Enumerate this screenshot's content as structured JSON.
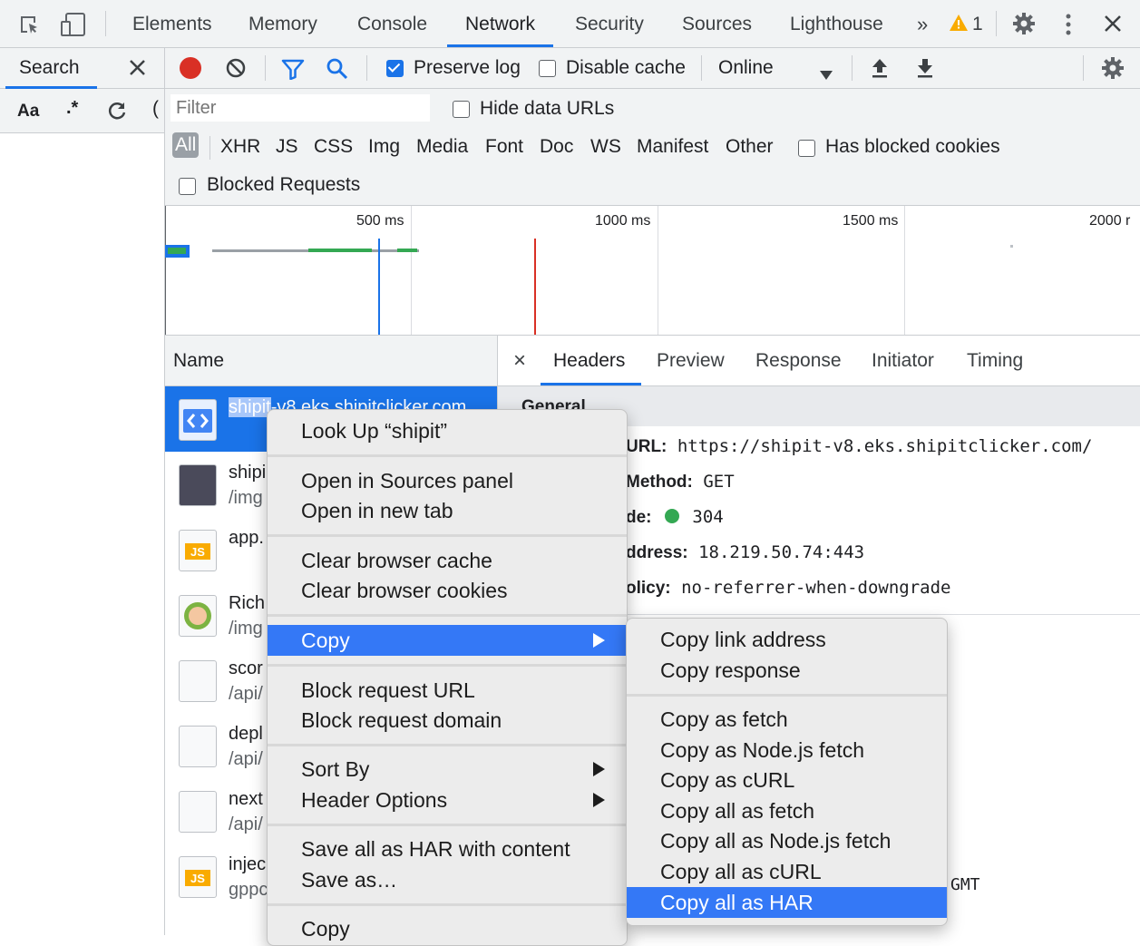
{
  "top_tabs": [
    "Elements",
    "Memory",
    "Console",
    "Network",
    "Security",
    "Sources",
    "Lighthouse"
  ],
  "top_right": {
    "overflow": "»",
    "warning_count": "1"
  },
  "search_panel": {
    "title": "Search",
    "case_toggle": "Aa",
    "regex_toggle": ".*"
  },
  "toolbar": {
    "preserve_log": "Preserve log",
    "disable_cache": "Disable cache",
    "throttle": "Online"
  },
  "filter": {
    "placeholder": "Filter",
    "hide_data_urls": "Hide data URLs",
    "types": [
      "All",
      "XHR",
      "JS",
      "CSS",
      "Img",
      "Media",
      "Font",
      "Doc",
      "WS",
      "Manifest",
      "Other"
    ],
    "has_blocked_cookies": "Has blocked cookies",
    "blocked_requests": "Blocked Requests"
  },
  "overview": {
    "ticks": [
      "500 ms",
      "1000 ms",
      "1500 ms",
      "2000 r"
    ]
  },
  "requests": {
    "column": "Name",
    "rows": [
      {
        "name": "shipit-v8.eks.shipitclicker.com",
        "path": "",
        "highlight": "shipit"
      },
      {
        "name": "shipi",
        "path": "/img"
      },
      {
        "name": "app.",
        "path": ""
      },
      {
        "name": "Rich",
        "path": "/img"
      },
      {
        "name": "scor",
        "path": "/api/"
      },
      {
        "name": "depl",
        "path": "/api/"
      },
      {
        "name": "next",
        "path": "/api/"
      },
      {
        "name": "injec",
        "path": "gppc"
      }
    ]
  },
  "details": {
    "close": "×",
    "tabs": [
      "Headers",
      "Preview",
      "Response",
      "Initiator",
      "Timing"
    ],
    "section": "General",
    "lines": [
      {
        "key": "URL:",
        "value": "https://shipit-v8.eks.shipitclicker.com/"
      },
      {
        "key": "Method:",
        "value": "GET"
      },
      {
        "key": "de:",
        "value": "304"
      },
      {
        "key": "ddress:",
        "value": "18.219.50.74:443"
      },
      {
        "key": "olicy:",
        "value": "no-referrer-when-downgrade"
      }
    ],
    "partial_gmt": "GMT"
  },
  "context_menu": {
    "items": [
      "Look Up “shipit”",
      "Open in Sources panel",
      "Open in new tab",
      "Clear browser cache",
      "Clear browser cookies",
      "Copy",
      "Block request URL",
      "Block request domain",
      "Sort By",
      "Header Options",
      "Save all as HAR with content",
      "Save as…",
      "Copy"
    ]
  },
  "copy_submenu": {
    "items": [
      "Copy link address",
      "Copy response",
      "Copy as fetch",
      "Copy as Node.js fetch",
      "Copy as cURL",
      "Copy all as fetch",
      "Copy all as Node.js fetch",
      "Copy all as cURL",
      "Copy all as HAR"
    ]
  },
  "colors": {
    "accent": "#1a73e8",
    "menu_highlight": "#3478f6",
    "record_red": "#d93025",
    "status_green": "#34a853"
  }
}
